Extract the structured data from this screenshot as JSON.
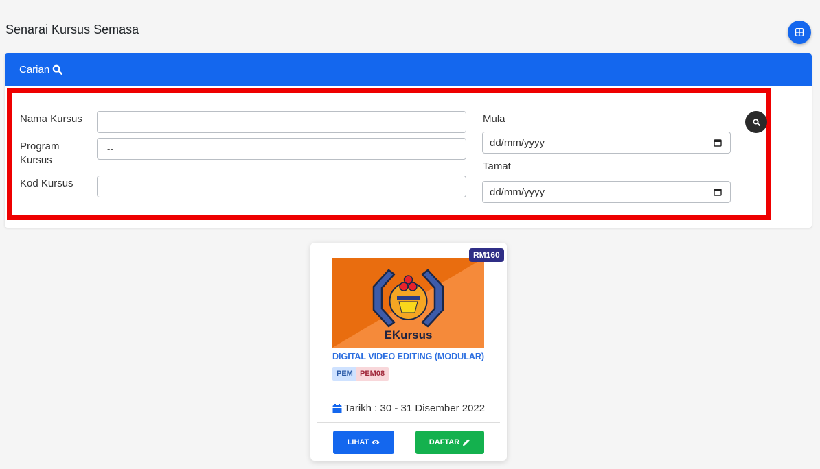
{
  "page": {
    "title": "Senarai Kursus Semasa"
  },
  "search": {
    "header": "Carian",
    "fields": {
      "course_name_label": "Nama Kursus",
      "course_name_value": "",
      "program_label": "Program Kursus",
      "program_value": "--",
      "course_code_label": "Kod Kursus",
      "course_code_value": "",
      "start_label": "Mula",
      "start_placeholder": "dd/mm/yyyy",
      "end_label": "Tamat",
      "end_placeholder": "dd/mm/yyyy"
    }
  },
  "course": {
    "price": "RM160",
    "image_caption": "EKursus",
    "title": "DIGITAL VIDEO EDITING (MODULAR)",
    "tags": [
      "PEM",
      "PEM08"
    ],
    "date": "Tarikh : 30 - 31 Disember 2022",
    "view_label": "LIHAT",
    "register_label": "DAFTAR"
  },
  "colors": {
    "primary": "#1467ee",
    "success": "#14b14e",
    "highlight": "#ee0000",
    "price_badge": "#2f2e86",
    "image_orange": "#f58a3a",
    "image_dark_orange": "#e96d0f"
  },
  "icons": [
    "grid-icon",
    "search-icon",
    "calendar-icon",
    "eye-icon",
    "pencil-icon"
  ]
}
